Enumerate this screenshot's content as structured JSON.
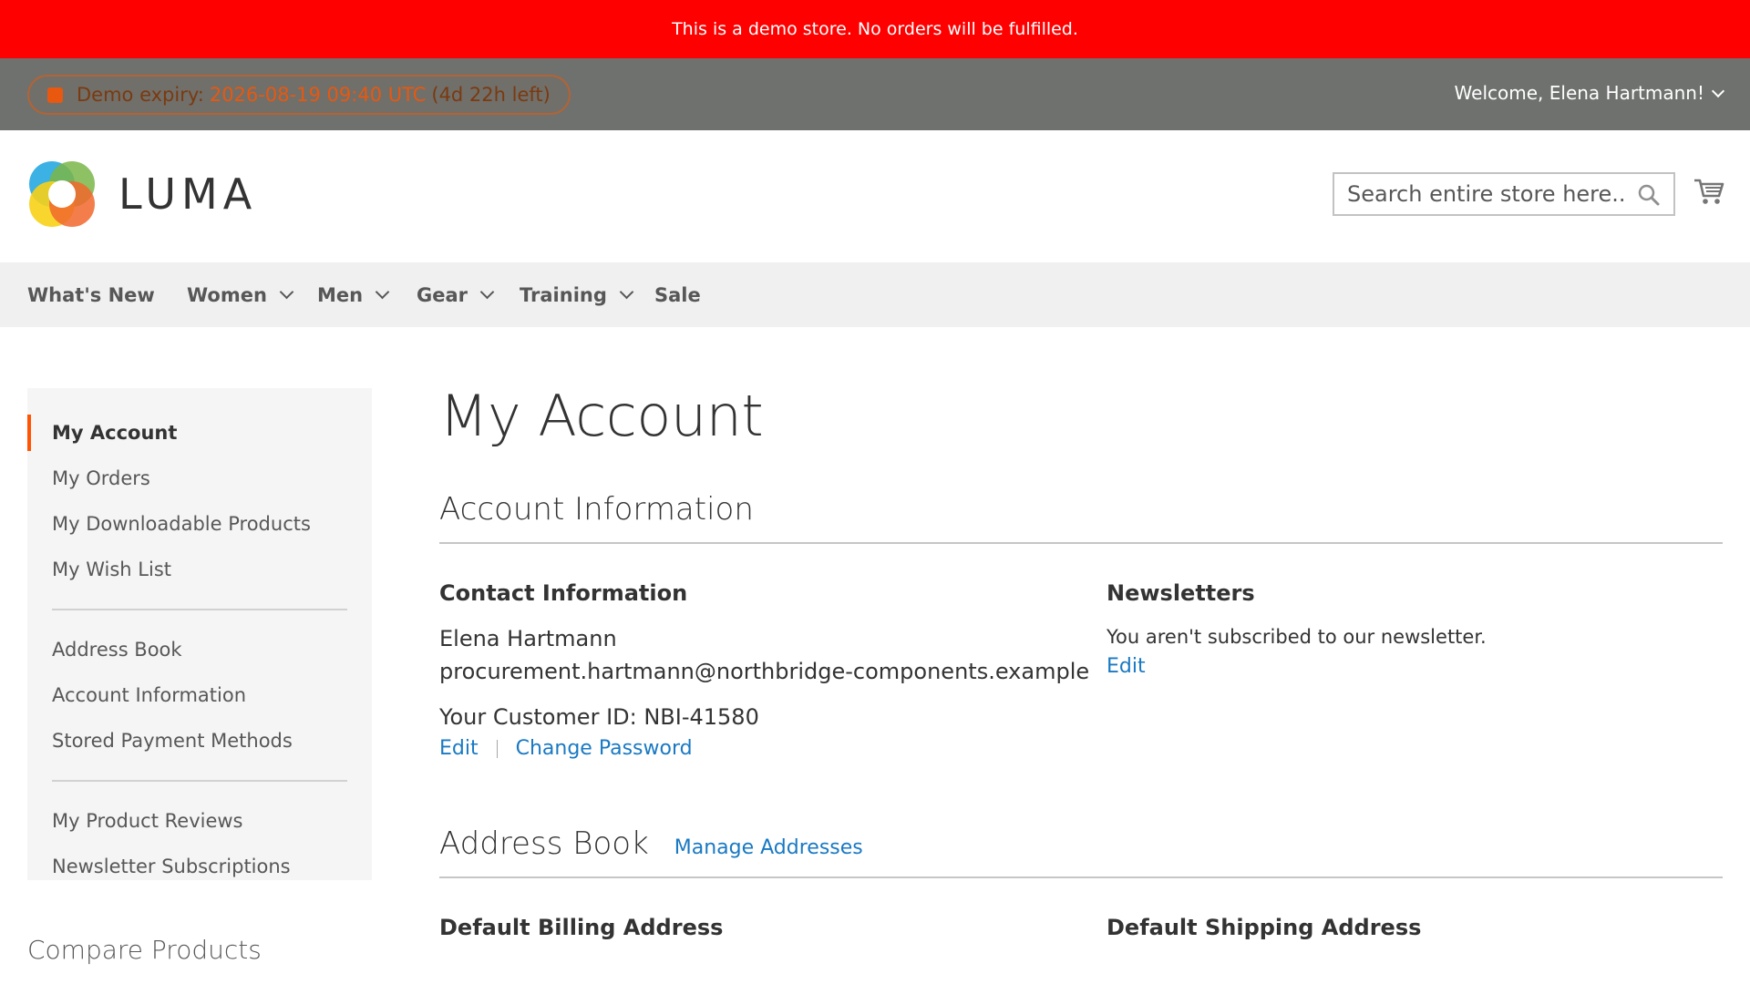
{
  "demo_notice": "This is a demo store. No orders will be fulfilled.",
  "header": {
    "expiry_label": "Demo expiry:",
    "expiry_date": "2026-08-19 09:40 UTC",
    "expiry_left": "(4d 22h left)",
    "welcome": "Welcome, Elena Hartmann!",
    "logo_text": "LUMA",
    "search_placeholder": "Search entire store here..."
  },
  "nav": {
    "items": [
      {
        "label": "What's New"
      },
      {
        "label": "Women"
      },
      {
        "label": "Men"
      },
      {
        "label": "Gear"
      },
      {
        "label": "Training"
      },
      {
        "label": "Sale"
      }
    ]
  },
  "sidebar": {
    "items": [
      {
        "label": "My Account"
      },
      {
        "label": "My Orders"
      },
      {
        "label": "My Downloadable Products"
      },
      {
        "label": "My Wish List"
      },
      {
        "label": "Address Book"
      },
      {
        "label": "Account Information"
      },
      {
        "label": "Stored Payment Methods"
      },
      {
        "label": "My Product Reviews"
      },
      {
        "label": "Newsletter Subscriptions"
      }
    ],
    "compare_title": "Compare Products"
  },
  "main": {
    "page_title": "My Account",
    "account_info": {
      "title": "Account Information",
      "contact": {
        "title": "Contact Information",
        "name": "Elena Hartmann",
        "email": "procurement.hartmann@northbridge-components.example",
        "customer_id": "Your Customer ID: NBI-41580",
        "edit": "Edit",
        "change_password": "Change Password"
      },
      "newsletters": {
        "title": "Newsletters",
        "status": "You aren't subscribed to our newsletter.",
        "edit": "Edit"
      }
    },
    "address_book": {
      "title": "Address Book",
      "manage": "Manage Addresses",
      "billing_title": "Default Billing Address",
      "shipping_title": "Default Shipping Address"
    }
  },
  "colors": {
    "banner": "#ff0000",
    "accent": "#ff5501",
    "link": "#1979c3",
    "panel": "#6e716e"
  }
}
